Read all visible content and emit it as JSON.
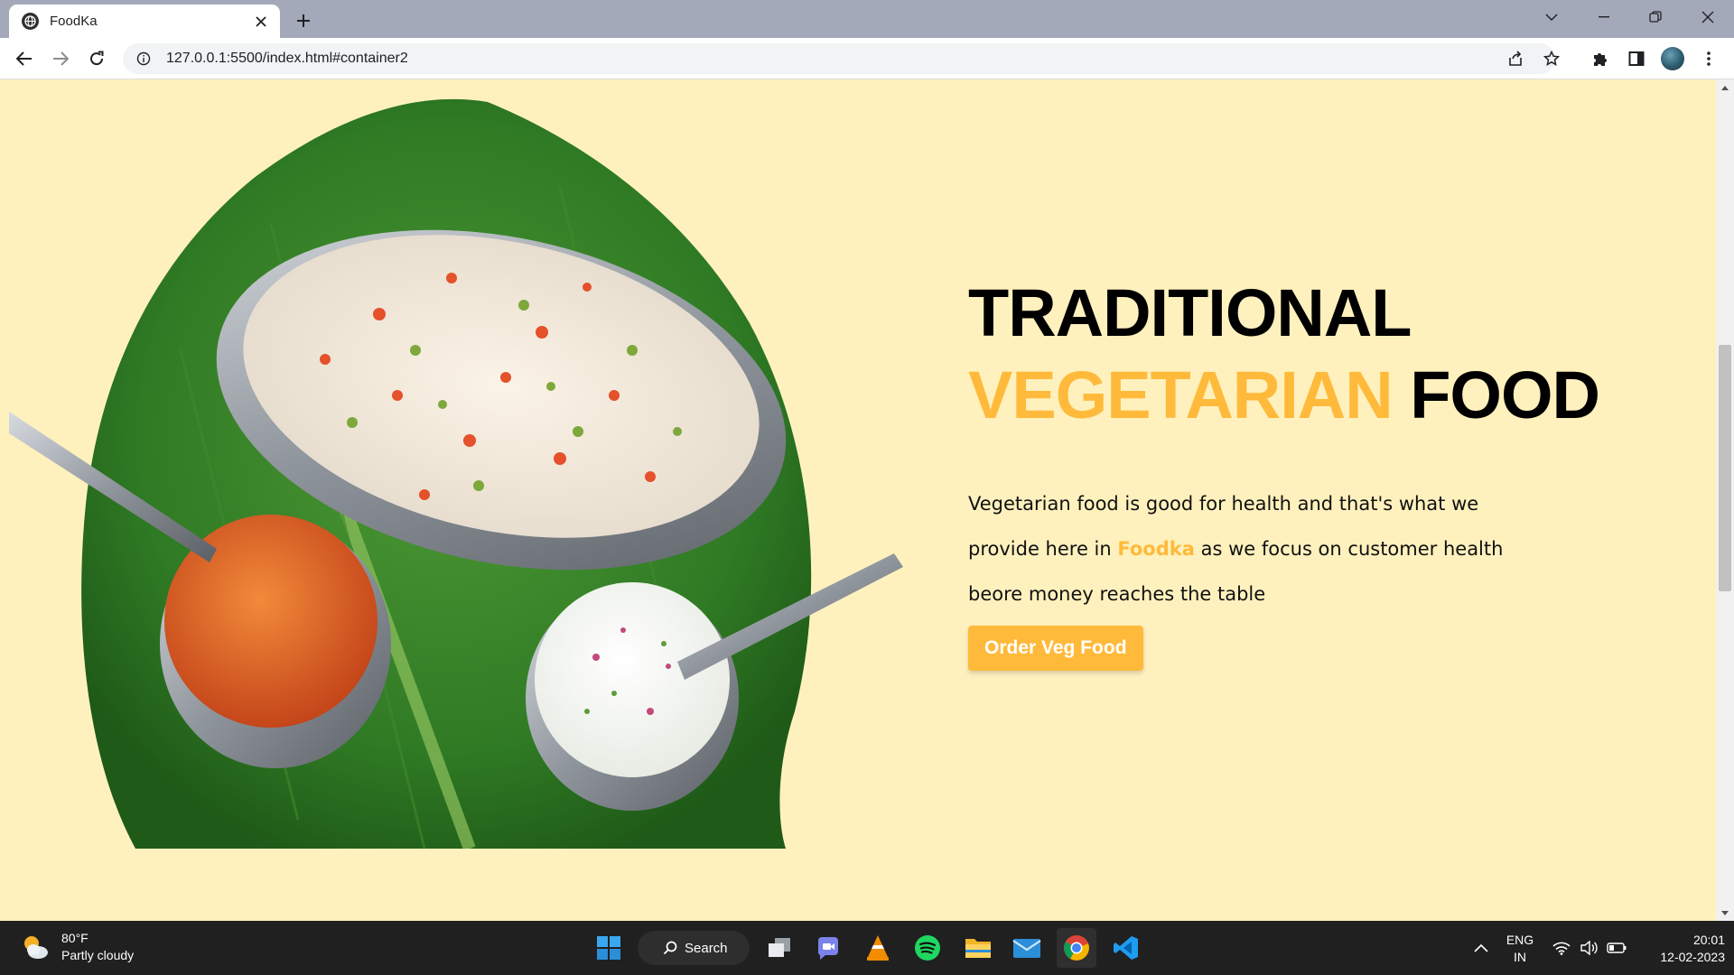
{
  "browser": {
    "tab": {
      "title": "FoodKa"
    },
    "omnibox": {
      "url": "127.0.0.1:5500/index.html#container2"
    }
  },
  "page": {
    "hero": {
      "title_line1": "TRADITIONAL",
      "title_accent": "VEGETARIAN",
      "title_rest": "FOOD",
      "desc_part1": "Vegetarian food is good for health and that's what we provide here in",
      "desc_brand": "Foodka",
      "desc_part2": "as we focus on customer health beore money reaches the table",
      "button_label": "Order Veg Food"
    },
    "colors": {
      "accent": "#ffba3b",
      "background": "#fff1bd"
    }
  },
  "taskbar": {
    "weather": {
      "temp": "80°F",
      "condition": "Partly cloudy"
    },
    "search_label": "Search",
    "language": {
      "line1": "ENG",
      "line2": "IN"
    },
    "clock": {
      "time": "20:01",
      "date": "12-02-2023"
    },
    "apps": [
      "windows-start-icon",
      "task-view-icon",
      "chat-icon",
      "vlc-icon",
      "spotify-icon",
      "file-explorer-icon",
      "mail-icon",
      "chrome-icon",
      "vscode-icon"
    ]
  }
}
